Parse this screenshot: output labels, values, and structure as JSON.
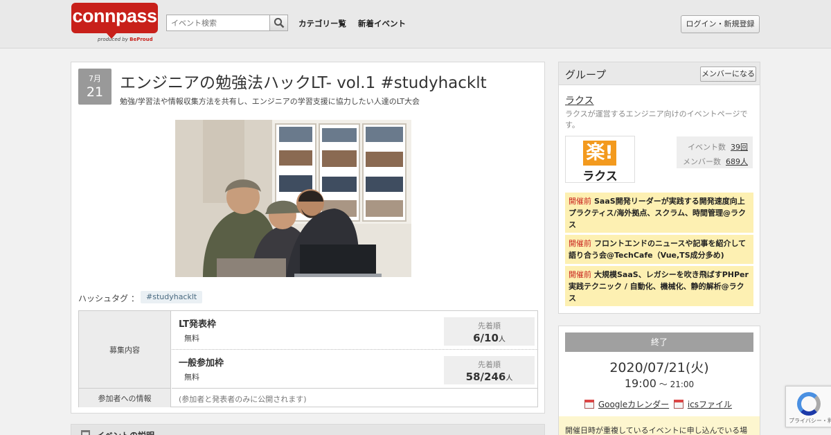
{
  "header": {
    "logo_text": "connpass",
    "logo_sub_prefix": "produced by",
    "logo_sub_brand": "BeProud",
    "search_placeholder": "イベント検索",
    "nav": [
      "カテゴリー覧",
      "新着イベント"
    ],
    "login_label": "ログイン・新規登録"
  },
  "event": {
    "month": "7月",
    "day": "21",
    "title": "エンジニアの勉強法ハックLT- vol.1 #studyhacklt",
    "subtitle": "勉強/学習法や情報収集方法を共有し、エンジニアの学習支援に協力したい人達のLT大会",
    "hashtag_label": "ハッシュタグ ：",
    "hashtag": "#studyhacklt",
    "recruit_label": "募集内容",
    "frames": [
      {
        "name": "LT発表枠",
        "price": "無料",
        "count_title": "先着順",
        "count": "6/10",
        "unit": "人"
      },
      {
        "name": "一般参加枠",
        "price": "無料",
        "count_title": "先着順",
        "count": "58/246",
        "unit": "人"
      }
    ],
    "info_label": "参加者への情報",
    "info_value": "(参加者と発表者のみに公開されます)",
    "description_heading": "イベントの説明"
  },
  "group": {
    "heading": "グループ",
    "member_button": "メンバーになる",
    "name": "ラクス",
    "description": "ラクスが運営するエンジニア向けのイベントページです。",
    "logo_mark": "楽!",
    "logo_text": "ラクス",
    "event_count_label": "イベント数",
    "event_count": "39回",
    "member_count_label": "メンバー数",
    "member_count": "689人",
    "events": [
      {
        "status": "開催前",
        "title": "SaaS開発リーダーが実践する開発速度向上プラクティス/海外拠点、スクラム、時間管理@ラクス"
      },
      {
        "status": "開催前",
        "title": "フロントエンドのニュースや記事を紹介して語り合う会@TechCafe（Vue,TS成分多め)"
      },
      {
        "status": "開催前",
        "title": "大規模SaaS、レガシーを吹き飛ばすPHPer実践テクニック / 自動化、機械化、静的解析@ラクス"
      }
    ]
  },
  "schedule": {
    "status": "終了",
    "date": "2020/07/21(火)",
    "time_start": "19:00",
    "time_sep": " ～ ",
    "time_end": "21:00",
    "google_calendar": "Googleカレンダー",
    "ics_file": "icsファイル",
    "notice": "開催日時が重複しているイベントに申し込んでいる場"
  },
  "recaptcha": {
    "text": "プライバシー・利用規約"
  }
}
